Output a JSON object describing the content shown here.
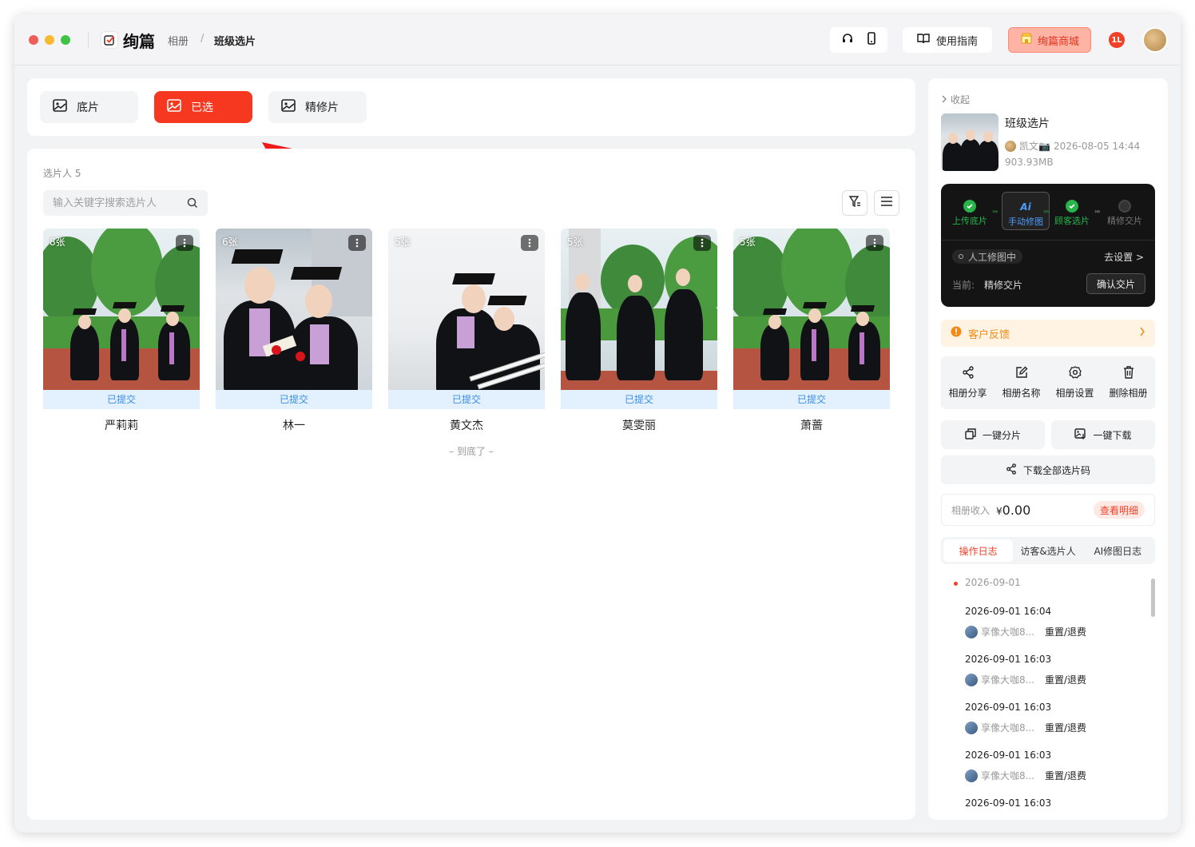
{
  "app": {
    "name": "绚篇",
    "breadcrumb": [
      "相册",
      "班级选片"
    ],
    "breadcrumb_sep": "/",
    "guide_label": "使用指南",
    "mall_label": "绚篇商城",
    "notification_badge": "1L",
    "accent_color": "#f5381f"
  },
  "tabs": [
    {
      "label": "底片",
      "icon": "image-icon",
      "active": false
    },
    {
      "label": "已选",
      "icon": "image-icon",
      "active": true
    },
    {
      "label": "精修片",
      "icon": "image-icon",
      "active": false
    }
  ],
  "main": {
    "count_label": "选片人 5",
    "search_placeholder": "输入关键字搜索选片人",
    "end_note": "– 到底了 –",
    "people": [
      {
        "name": "严莉莉",
        "count": "8张",
        "status": "已提交"
      },
      {
        "name": "林一",
        "count": "6张",
        "status": "已提交"
      },
      {
        "name": "黄文杰",
        "count": "5张",
        "status": "已提交"
      },
      {
        "name": "莫雯丽",
        "count": "5张",
        "status": "已提交"
      },
      {
        "name": "萧蔷",
        "count": "5张",
        "status": "已提交"
      }
    ]
  },
  "sidebar": {
    "collapse_label": "收起",
    "album_title": "班级选片",
    "album_owner": "凯文📷",
    "album_date": "2026-08-05 14:44",
    "album_size": "903.93MB",
    "workflow": {
      "steps": [
        {
          "label": "上传底片",
          "state": "done"
        },
        {
          "label": "手动修图",
          "state": "active",
          "icon_text": "Ai"
        },
        {
          "label": "顾客选片",
          "state": "done"
        },
        {
          "label": "精修交片",
          "state": "pending"
        }
      ],
      "status": "人工修图中",
      "setting_link": "去设置 >",
      "current_label": "当前:",
      "current_value": "精修交片",
      "confirm_label": "确认交片"
    },
    "feedback_label": "客户反馈",
    "actions": [
      {
        "label": "相册分享",
        "icon": "share-icon"
      },
      {
        "label": "相册名称",
        "icon": "edit-icon"
      },
      {
        "label": "相册设置",
        "icon": "gear-icon"
      },
      {
        "label": "删除相册",
        "icon": "trash-icon"
      }
    ],
    "split_label": "一键分片",
    "download_label": "一键下载",
    "codes_label": "下载全部选片码",
    "income_label": "相册收入",
    "income_currency": "¥",
    "income_value": "0.00",
    "income_detail": "查看明细",
    "log_tabs": [
      {
        "label": "操作日志",
        "active": true
      },
      {
        "label": "访客&选片人",
        "active": false
      },
      {
        "label": "AI修图日志",
        "active": false
      }
    ],
    "log_date": "2026-09-01",
    "logs": [
      {
        "time": "2026-09-01 16:04",
        "user": "享像大咖8...",
        "action": "重置/退费"
      },
      {
        "time": "2026-09-01 16:03",
        "user": "享像大咖8...",
        "action": "重置/退费"
      },
      {
        "time": "2026-09-01 16:03",
        "user": "享像大咖8...",
        "action": "重置/退费"
      },
      {
        "time": "2026-09-01 16:03",
        "user": "享像大咖8...",
        "action": "重置/退费"
      },
      {
        "time": "2026-09-01 16:03",
        "user": "",
        "action": ""
      }
    ]
  }
}
